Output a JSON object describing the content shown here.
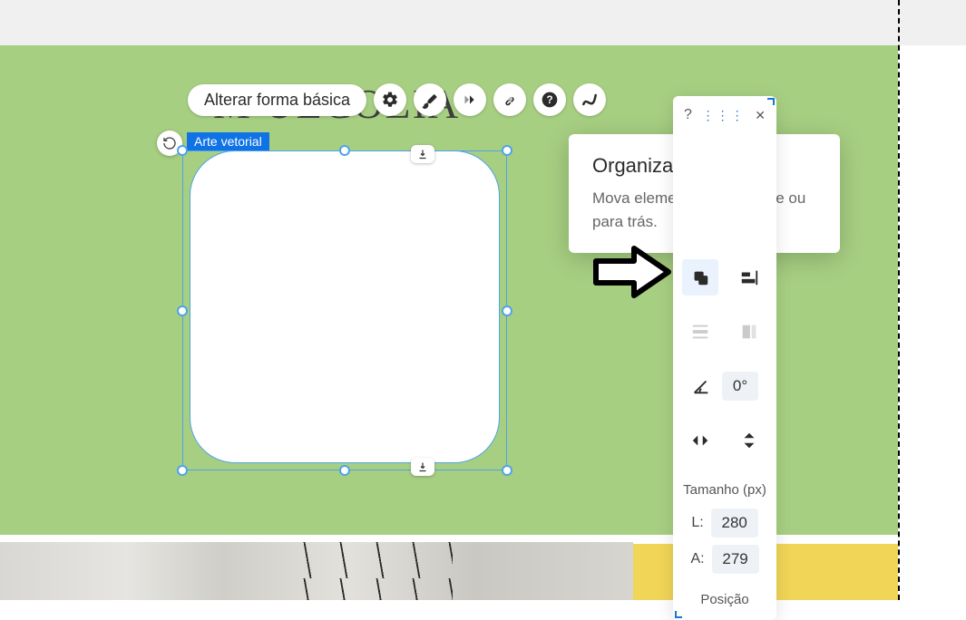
{
  "toolbar": {
    "change_shape_label": "Alterar forma básica"
  },
  "selection": {
    "label": "Arte vetorial"
  },
  "ghost_title": "M        UECOLIA",
  "tooltip": {
    "title": "Organizar",
    "body": "Mova elementos para frente ou para trás."
  },
  "panel": {
    "help": "?",
    "close": "✕",
    "angle_value": "0°",
    "size_title": "Tamanho (px)",
    "width_label": "L:",
    "width_value": "280",
    "height_label": "A:",
    "height_value": "279",
    "position_title": "Posição"
  }
}
